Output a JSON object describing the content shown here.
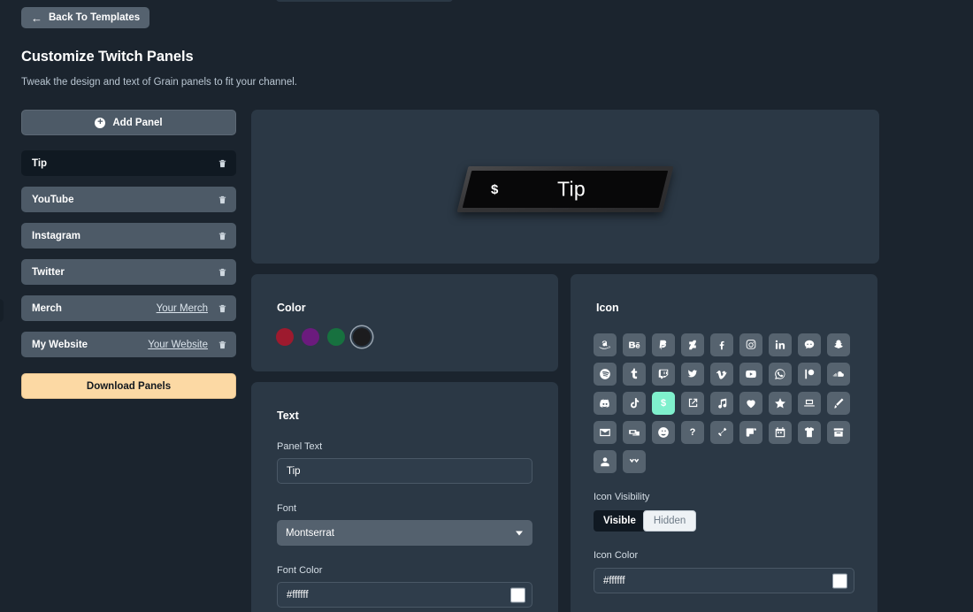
{
  "header": {
    "back_label": "Back To Templates",
    "back_icon": "arrow-left-icon",
    "title": "Customize Twitch Panels",
    "subtitle": "Tweak the design and text of Grain panels to fit your channel."
  },
  "sidebar": {
    "add_panel_label": "Add Panel",
    "add_panel_icon": "plus-circle-icon",
    "download_label": "Download Panels",
    "panels": [
      {
        "name": "Tip",
        "link": "",
        "selected": true
      },
      {
        "name": "YouTube",
        "link": "",
        "selected": false
      },
      {
        "name": "Instagram",
        "link": "",
        "selected": false
      },
      {
        "name": "Twitter",
        "link": "",
        "selected": false
      },
      {
        "name": "Merch",
        "link": "Your Merch",
        "selected": false
      },
      {
        "name": "My Website",
        "link": "Your Website",
        "selected": false
      }
    ]
  },
  "preview": {
    "text": "Tip",
    "icon": "dollar-icon",
    "icon_glyph": "$",
    "panel_bg": "#080809",
    "frame_color": "#3a3a3c",
    "text_color": "#ffffff"
  },
  "color_section": {
    "title": "Color",
    "swatches": [
      {
        "name": "crimson",
        "hex": "#9d1a2e",
        "selected": false
      },
      {
        "name": "purple",
        "hex": "#6b1b7d",
        "selected": false
      },
      {
        "name": "green",
        "hex": "#17713f",
        "selected": false
      },
      {
        "name": "black",
        "hex": "#1c1c1e",
        "selected": true
      }
    ]
  },
  "text_section": {
    "title": "Text",
    "panel_text_label": "Panel Text",
    "panel_text_value": "Tip",
    "panel_text_placeholder": "Panel Text",
    "font_label": "Font",
    "font_value": "Montserrat",
    "font_color_label": "Font Color",
    "font_color_value": "#ffffff",
    "font_color_swatch": "#ffffff"
  },
  "icon_section": {
    "title": "Icon",
    "visibility_label": "Icon Visibility",
    "visible_label": "Visible",
    "hidden_label": "Hidden",
    "visibility_selected": "Visible",
    "icon_color_label": "Icon Color",
    "icon_color_value": "#ffffff",
    "icon_color_swatch": "#ffffff",
    "active_icon": "dollar-icon",
    "active_bg": "#7ff0cd",
    "icons": [
      "amazon-icon",
      "behance-icon",
      "paypal-icon",
      "deviantart-icon",
      "facebook-icon",
      "instagram-icon",
      "linkedin-icon",
      "reddit-icon",
      "snapchat-icon",
      "spotify-icon",
      "tumblr-icon",
      "twitch-icon",
      "twitter-icon",
      "vimeo-icon",
      "youtube-icon",
      "whatsapp-icon",
      "patreon-icon",
      "soundcloud-icon",
      "discord-icon",
      "tiktok-icon",
      "dollar-icon",
      "external-link-icon",
      "music-note-icon",
      "heart-icon",
      "star-icon",
      "laptop-icon",
      "paintbrush-icon",
      "envelope-icon",
      "donate-icon",
      "smiley-icon",
      "question-mark-icon",
      "hammer-icon",
      "scroll-icon",
      "calendar-icon",
      "tshirt-icon",
      "archive-icon",
      "person-icon",
      "chevron-double-icon"
    ]
  }
}
